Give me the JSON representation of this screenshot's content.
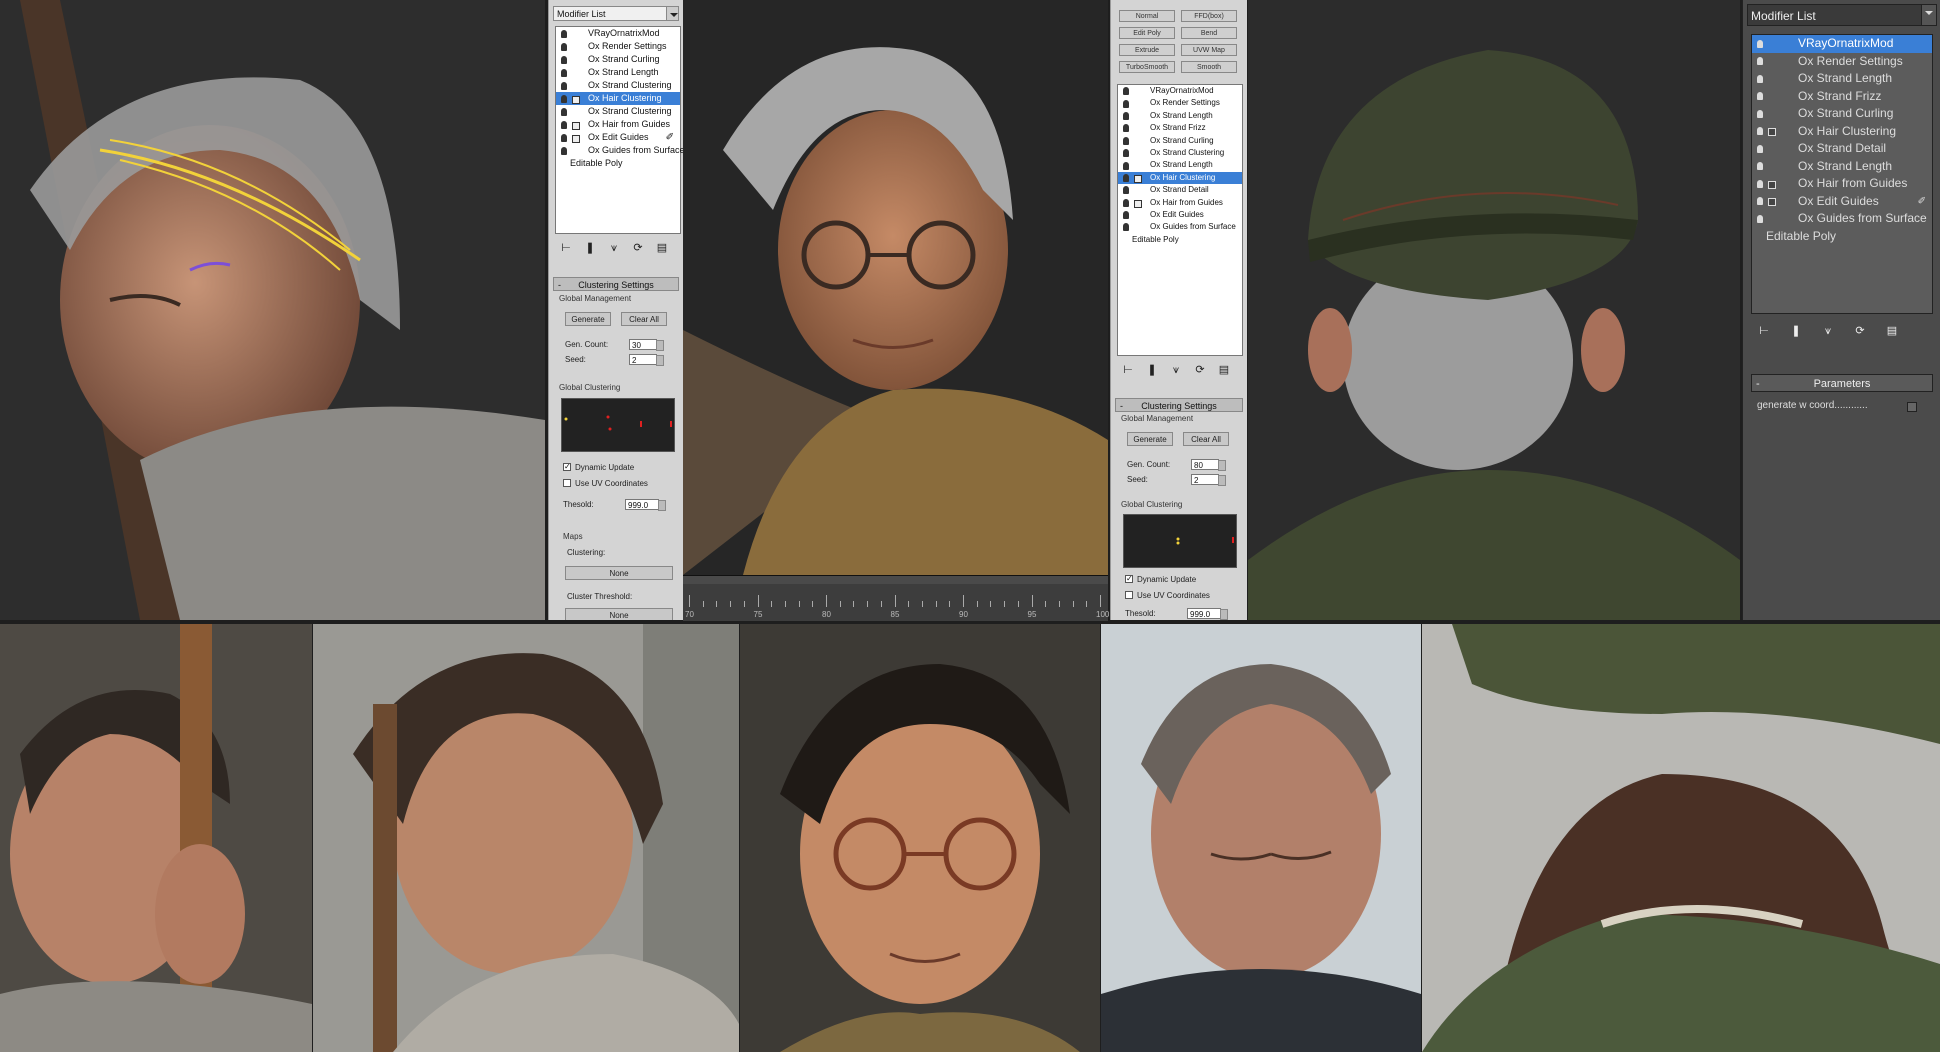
{
  "panel1": {
    "modifier_list_label": "Modifier List",
    "stack": [
      {
        "label": "VRayOrnatrixMod",
        "selected": false,
        "box": false
      },
      {
        "label": "Ox Render Settings",
        "selected": false,
        "box": false
      },
      {
        "label": "Ox Strand Curling",
        "selected": false,
        "box": false
      },
      {
        "label": "Ox Strand Length",
        "selected": false,
        "box": false
      },
      {
        "label": "Ox Strand Clustering",
        "selected": false,
        "box": false
      },
      {
        "label": "Ox Hair Clustering",
        "selected": true,
        "box": true
      },
      {
        "label": "Ox Strand Clustering",
        "selected": false,
        "box": false
      },
      {
        "label": "Ox Hair from Guides",
        "selected": false,
        "box": true
      },
      {
        "label": "Ox Edit Guides",
        "selected": false,
        "box": true,
        "pen": true
      },
      {
        "label": "Ox Guides from Surface",
        "selected": false,
        "box": false
      },
      {
        "label": "Editable Poly",
        "selected": false,
        "box": false,
        "plain": true
      }
    ],
    "rollout_title": "Clustering Settings",
    "global_management": "Global Management",
    "generate": "Generate",
    "clear_all": "Clear All",
    "gen_count_label": "Gen. Count:",
    "gen_count": "30",
    "seed_label": "Seed:",
    "seed": "2",
    "global_clustering": "Global Clustering",
    "dynamic_update": "Dynamic Update",
    "use_uv": "Use UV Coordinates",
    "threshold_label": "Thesold:",
    "threshold": "999.0",
    "maps_label": "Maps",
    "clustering_label": "Clustering:",
    "none1": "None",
    "cluster_threshold_label": "Cluster Threshold:",
    "none2": "None"
  },
  "panel2": {
    "top_buttons": [
      "Normal",
      "FFD(box)",
      "Edit Poly",
      "Bend",
      "Extrude",
      "UVW Map",
      "TurboSmooth",
      "Smooth"
    ],
    "stack": [
      {
        "label": "VRayOrnatrixMod",
        "selected": false,
        "box": false
      },
      {
        "label": "Ox Render Settings",
        "selected": false,
        "box": false
      },
      {
        "label": "Ox Strand Length",
        "selected": false,
        "box": false
      },
      {
        "label": "Ox Strand Frizz",
        "selected": false,
        "box": false
      },
      {
        "label": "Ox Strand Curling",
        "selected": false,
        "box": false
      },
      {
        "label": "Ox Strand Clustering",
        "selected": false,
        "box": false
      },
      {
        "label": "Ox Strand Length",
        "selected": false,
        "box": false
      },
      {
        "label": "Ox Hair Clustering",
        "selected": true,
        "box": true
      },
      {
        "label": "Ox Strand Detail",
        "selected": false,
        "box": false
      },
      {
        "label": "Ox Hair from Guides",
        "selected": false,
        "box": true
      },
      {
        "label": "Ox Edit Guides",
        "selected": false,
        "box": false
      },
      {
        "label": "Ox Guides from Surface",
        "selected": false,
        "box": false
      },
      {
        "label": "Editable Poly",
        "selected": false,
        "box": false,
        "plain": true
      }
    ],
    "rollout_title": "Clustering Settings",
    "global_management": "Global Management",
    "generate": "Generate",
    "clear_all": "Clear All",
    "gen_count_label": "Gen. Count:",
    "gen_count": "80",
    "seed_label": "Seed:",
    "seed": "2",
    "global_clustering": "Global Clustering",
    "dynamic_update": "Dynamic Update",
    "use_uv": "Use UV Coordinates",
    "threshold_label": "Thesold:",
    "threshold": "999.0"
  },
  "timeline": {
    "labels": [
      "70",
      "75",
      "80",
      "85",
      "90",
      "95",
      "100"
    ]
  },
  "panel3": {
    "modifier_list_label": "Modifier List",
    "stack": [
      {
        "label": "VRayOrnatrixMod",
        "selected": true,
        "box": false
      },
      {
        "label": "Ox Render Settings",
        "selected": false,
        "box": false
      },
      {
        "label": "Ox Strand Length",
        "selected": false,
        "box": false
      },
      {
        "label": "Ox Strand Frizz",
        "selected": false,
        "box": false
      },
      {
        "label": "Ox Strand Curling",
        "selected": false,
        "box": false
      },
      {
        "label": "Ox Hair Clustering",
        "selected": false,
        "box": true
      },
      {
        "label": "Ox Strand Detail",
        "selected": false,
        "box": false
      },
      {
        "label": "Ox Strand Length",
        "selected": false,
        "box": false
      },
      {
        "label": "Ox Hair from Guides",
        "selected": false,
        "box": true
      },
      {
        "label": "Ox Edit Guides",
        "selected": false,
        "box": true,
        "pen": true
      },
      {
        "label": "Ox Guides from Surface",
        "selected": false,
        "box": false
      },
      {
        "label": "Editable Poly",
        "selected": false,
        "box": false,
        "plain": true
      }
    ],
    "rollout_title": "Parameters",
    "param_label": "generate w coord............"
  },
  "colors": {
    "selection": "#3a7fd6",
    "hair_guides": "#f2d23a"
  }
}
